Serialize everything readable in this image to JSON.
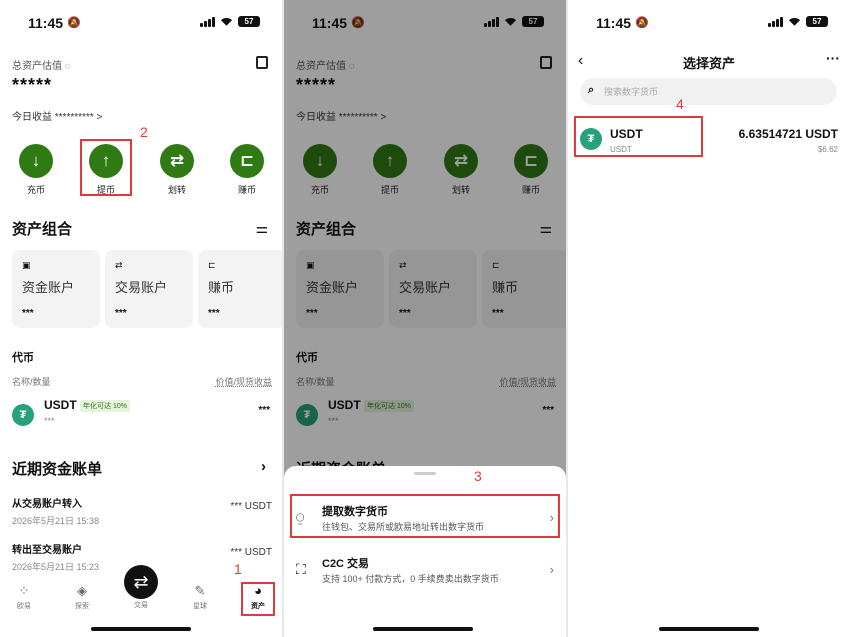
{
  "status": {
    "time": "11:45",
    "battery": "57"
  },
  "wallet": {
    "total_label": "总资产估值",
    "total_value": "*****",
    "today_label": "今日收益 ********** >",
    "actions": [
      {
        "label": "充币",
        "icon": "deposit-icon"
      },
      {
        "label": "提币",
        "icon": "withdraw-icon"
      },
      {
        "label": "划转",
        "icon": "transfer-icon"
      },
      {
        "label": "赚币",
        "icon": "earn-icon"
      }
    ],
    "portfolio_title": "资产组合",
    "accounts": [
      {
        "name": "资金账户",
        "value": "***"
      },
      {
        "name": "交易账户",
        "value": "***"
      },
      {
        "name": "赚币",
        "value": "***"
      }
    ],
    "coins_title": "代币",
    "coins_col_left": "名称/数量",
    "coins_col_right": "价值/现货收益",
    "coin": {
      "name": "USDT",
      "tag": "年化可达 10%",
      "amount": "***",
      "value": "***"
    },
    "records_title": "近期资金账单",
    "records": [
      {
        "title": "从交易账户转入",
        "time": "2026年5月21日 15:38",
        "amount": "*** USDT"
      },
      {
        "title": "转出至交易账户",
        "time": "2026年5月21日 15:23",
        "amount": "*** USDT"
      }
    ],
    "tabs": [
      "欧易",
      "探索",
      "交易",
      "星球",
      "资产"
    ]
  },
  "sheet": {
    "options": [
      {
        "title": "提取数字货币",
        "desc": "往钱包、交易所或欧易地址转出数字货币",
        "icon": "withdraw-icon"
      },
      {
        "title": "C2C 交易",
        "desc": "支持 100+ 付款方式，0 手续费卖出数字货币",
        "icon": "c2c-icon"
      }
    ]
  },
  "select": {
    "title": "选择资产",
    "search_placeholder": "搜索数字货币",
    "asset": {
      "name": "USDT",
      "sub": "USDT",
      "amount": "6.63514721 USDT",
      "value": "$6.62"
    }
  },
  "steps": [
    "1",
    "2",
    "3",
    "4"
  ],
  "colors": {
    "accent_green": "#2f7a12",
    "annotation_red": "#e03a3a",
    "usdt": "#26a17b"
  }
}
